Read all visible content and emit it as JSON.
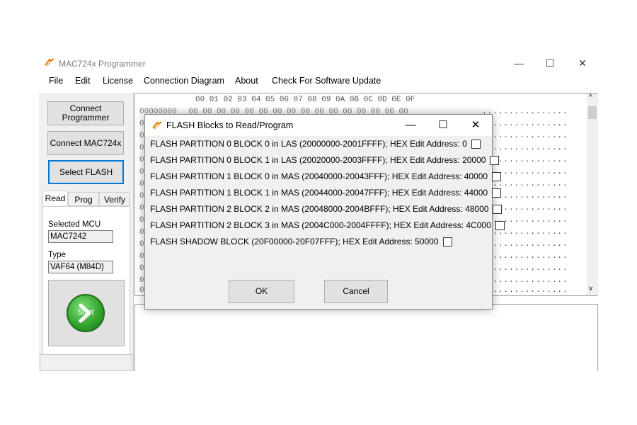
{
  "window": {
    "title": "MAC724x Programmer",
    "controls": {
      "minimize": "—",
      "maximize": "☐",
      "close": "✕"
    }
  },
  "menu": [
    "File",
    "Edit",
    "License",
    "Connection Diagram",
    "About",
    "Check For Software Update"
  ],
  "left_panel": {
    "connect_programmer": "Connect Programmer",
    "connect_mac": "Connect MAC724x",
    "select_flash": "Select FLASH",
    "tabs": [
      "Read",
      "Prog",
      "Verify"
    ],
    "selected_mcu_label": "Selected MCU",
    "selected_mcu_value": "MAC7242",
    "type_label": "Type",
    "type_value": "VAF64 (M84D)",
    "start_label": "Start"
  },
  "hex": {
    "header": "00 01 02 03 04 05 06 07 08 09 0A 0B 0C 0D 0E 0F",
    "first_address": "00000000",
    "first_row_bytes": "00 00 00 00 00 00 00 00 00 00 00 00 00 00 00 00",
    "row_prefix": "0",
    "dots": "................"
  },
  "dialog": {
    "title": "FLASH Blocks to Read/Program",
    "controls": {
      "minimize": "—",
      "maximize": "☐",
      "close": "✕"
    },
    "options": [
      "FLASH PARTITION 0 BLOCK 0 in LAS (20000000-2001FFFF); HEX Edit Address: 0",
      "FLASH PARTITION 0 BLOCK 1 in LAS (20020000-2003FFFF); HEX Edit Address: 20000",
      "FLASH PARTITION 1 BLOCK 0 in MAS (20040000-20043FFF); HEX Edit Address: 40000",
      "FLASH PARTITION 1 BLOCK 1 in MAS (20044000-20047FFF); HEX Edit Address: 44000",
      "FLASH PARTITION 2 BLOCK 2 in MAS (20048000-2004BFFF); HEX Edit Address: 48000",
      "FLASH PARTITION 2 BLOCK 3 in MAS (2004C000-2004FFFF); HEX Edit Address: 4C000",
      "FLASH SHADOW BLOCK (20F00000-20F07FFF); HEX Edit Address: 50000"
    ],
    "ok": "OK",
    "cancel": "Cancel"
  }
}
